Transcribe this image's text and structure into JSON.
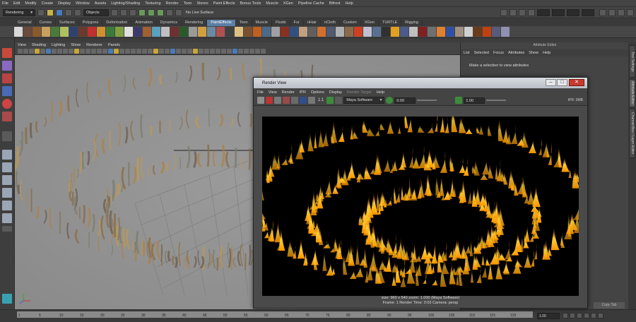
{
  "menubar": {
    "items": [
      "File",
      "Edit",
      "Modify",
      "Create",
      "Display",
      "Window",
      "Assets",
      "Lighting/Shading",
      "Texturing",
      "Render",
      "Toon",
      "Stereo",
      "Paint Effects",
      "Bonus Tools",
      "Muscle",
      "XGen",
      "Pipeline Cache",
      "Bifrost",
      "Help"
    ]
  },
  "status": {
    "menuset": "Rendering",
    "selection_mode": "Objects",
    "live_surface": "No Live Surface"
  },
  "shelf": {
    "tabs": [
      "General",
      "Curves",
      "Surfaces",
      "Polygons",
      "Deformation",
      "Animation",
      "Dynamics",
      "Rendering",
      "PaintEffects",
      "Toon",
      "Muscle",
      "Fluids",
      "Fur",
      "nHair",
      "nCloth",
      "Custom",
      "XGen",
      "TURTLE",
      "Rigging"
    ],
    "active": "PaintEffects"
  },
  "viewport": {
    "menu": [
      "View",
      "Shading",
      "Lighting",
      "Show",
      "Renderer",
      "Panels"
    ]
  },
  "attribute_editor": {
    "title": "Attribute Editor",
    "menu": [
      "List",
      "Selected",
      "Focus",
      "Attributes",
      "Show",
      "Help"
    ],
    "message": "Make a selection to view attributes",
    "bottom_button": "Copy Tab"
  },
  "side_tabs": [
    "Tool Settings",
    "Attribute Editor",
    "Channel Box / Layer Editor"
  ],
  "render_view": {
    "title": "Render View",
    "menu": [
      "File",
      "View",
      "Render",
      "IPR",
      "Options",
      "Display",
      "Render Target",
      "Help"
    ],
    "renderer": "Maya Software",
    "exposure": "0.00",
    "gamma": "1.00",
    "ratio_label": "1:1",
    "flags": "IPR: 0MB",
    "info_line1": "size: 960 x 540  zoom: 1.000     (Maya Software)",
    "info_line2": "Frame: 1      Render Time: 0:03      Camera: persp"
  },
  "timeline": {
    "ticks": [
      "1",
      "5",
      "10",
      "15",
      "20",
      "25",
      "30",
      "35",
      "40",
      "45",
      "50",
      "55",
      "60",
      "65",
      "70",
      "75",
      "80",
      "85",
      "90",
      "95",
      "100",
      "105",
      "110",
      "115",
      "120"
    ],
    "current_frame": "1.00"
  },
  "colors": {
    "accent": "#5d7fa6",
    "panel": "#444444",
    "viewport": "#a0a0a0"
  }
}
